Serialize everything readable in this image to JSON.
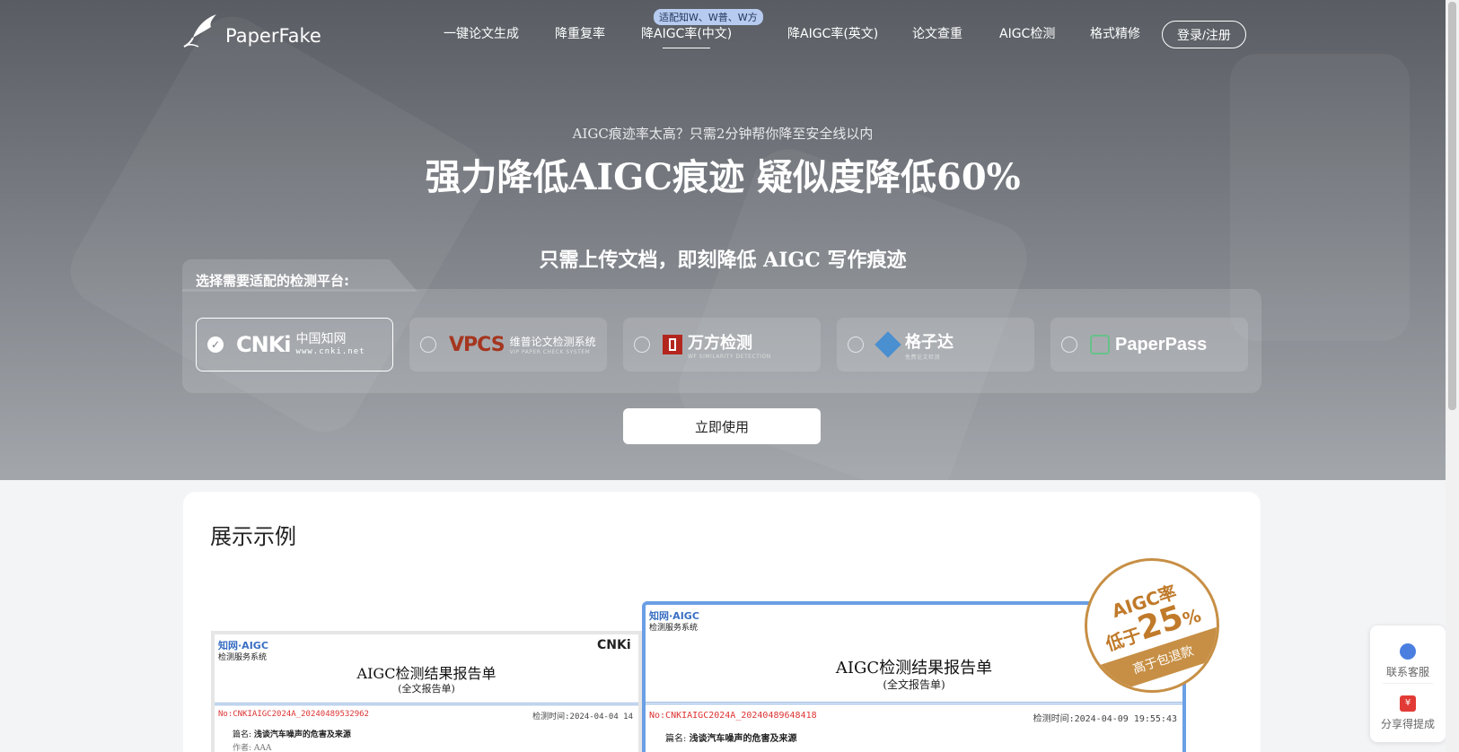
{
  "nav": {
    "brand": "PaperFake",
    "items": [
      "一键论文生成",
      "降重复率",
      "降AIGC率(中文)",
      "降AIGC率(英文)",
      "论文查重",
      "AIGC检测",
      "格式精修"
    ],
    "badge": "适配知W、W普、W方",
    "login": "登录/注册"
  },
  "hero": {
    "subtitle": "AIGC痕迹率太高？只需2分钟帮你降至安全线以内",
    "headline": "强力降低AIGC痕迹 疑似度降低60%",
    "tagline": "只需上传文档，即刻降低 AIGC 写作痕迹",
    "platform_label": "选择需要适配的检测平台:",
    "platforms": {
      "cnki": {
        "mark": "CNKi",
        "cn": "中国知网",
        "url": "www.cnki.net",
        "selected": true
      },
      "vpcs": {
        "mark": "VPCS",
        "cn": "维普论文检测系统",
        "en": "VIP PAPER CHECK SYSTEM"
      },
      "wanfang": {
        "cn": "万方检测",
        "en": "WF SIMILARITY DETECTION"
      },
      "gezida": {
        "cn": "格子达",
        "en": "免费论文检测"
      },
      "paperpass": {
        "name": "PaperPass"
      }
    },
    "cta": "立即使用"
  },
  "showcase": {
    "title": "展示示例",
    "report_back": {
      "brand": "知网·AIGC",
      "brand_sub": "检测服务系统",
      "title": "AIGC检测结果报告单",
      "sub": "(全文报告单)",
      "number": "No:CNKIAIGC2024A_20240489532962",
      "time": "检测时间:2024-04-04 14",
      "field_label": "篇名:",
      "field_value": "浅谈汽车噪声的危害及来源",
      "author_label": "作者:",
      "author_value": "AAA"
    },
    "report_front": {
      "brand": "知网·AIGC",
      "brand_sub": "检测服务系统",
      "title": "AIGC检测结果报告单",
      "sub": "(全文报告单)",
      "number": "No:CNKIAIGC2024A_20240489648418",
      "time": "检测时间:2024-04-09 19:55:43",
      "field_label": "篇名:",
      "field_value": "浅谈汽车噪声的危害及来源"
    },
    "stamp": {
      "line1": "AIGC率",
      "line2_pre": "低于",
      "percent": "25",
      "unit": "%",
      "band": "高于包退款"
    }
  },
  "float": {
    "support": "联系客服",
    "share": "分享得提成",
    "share_glyph": "¥"
  },
  "colors": {
    "accent_blue": "#6b9fe5",
    "stamp_gold": "#c78f45",
    "hero_top": "#595d63"
  }
}
